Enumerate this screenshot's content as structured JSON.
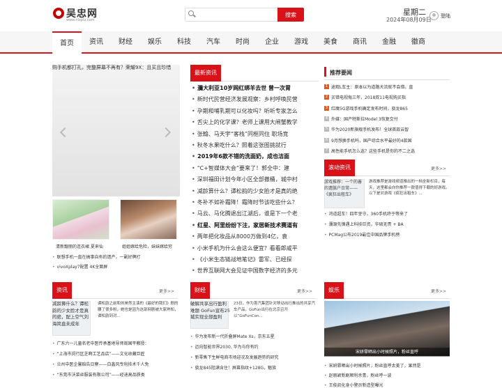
{
  "header": {
    "logo_text": "吴忠网",
    "logo_sub": "www.nlxplz.com",
    "search_button": "搜索",
    "weekday": "星期二",
    "date": "2024年08月09日",
    "login": "登陆"
  },
  "nav": {
    "items": [
      "首页",
      "资讯",
      "财经",
      "娱乐",
      "科技",
      "汽车",
      "时尚",
      "企业",
      "游戏",
      "美食",
      "商讯",
      "金融",
      "徽商"
    ]
  },
  "slider": {
    "caption": "购手机都打孔，完整屏幕不再有？荣耀9X：且买且珍惜"
  },
  "thumbs": [
    {
      "caption": "清新靓丽的连衣裙 夏来仙"
    },
    {
      "caption": "姐姐嫁给危险，妹妹嫁给穷"
    }
  ],
  "left_links": [
    "联想手机一直在搞事自有的遗产，一副好牌打",
    "vivoXplay7配置 4K全面屏"
  ],
  "latest": {
    "title": "最新资讯",
    "items": [
      {
        "text": "瀰大利亚10岁网红绑羊去世 曾一次胃",
        "bold": true
      },
      {
        "text": "新时代民营经济发展观察：乡村呼唤民营",
        "bold": false
      },
      {
        "text": "孕期和哺乳期可以化妆吗？听听专家怎么",
        "bold": false
      },
      {
        "text": "舌尖上的化学课？老师上课用大闸蟹教学",
        "bold": false
      },
      {
        "text": "张翰、马天宇“客栈”同框同住 职场竞",
        "bold": false
      },
      {
        "text": "秋冬水果吃什么？照着这张图挑就行",
        "bold": false
      },
      {
        "text": "2019年6款不错的洗面奶，成也洁面",
        "bold": true
      },
      {
        "text": "“C+智媒体大会”要来了！郭全中：建",
        "bold": false
      },
      {
        "text": "深圳福田计划今年小区全部撤桶，城中村",
        "bold": false
      },
      {
        "text": "减龄算什么？谭松韵的少女脸才是真的绝",
        "bold": false
      },
      {
        "text": "冬补不如补霜降！霜降时节该吃些什么？",
        "bold": false
      },
      {
        "text": "马云、马化腾退出江湖后，谁是下一个老",
        "bold": false
      },
      {
        "text": "红星、阿里纷纷下注，家居新技术赛道有",
        "bold": true
      },
      {
        "text": "两年把化妆品从8000万做到4亿，袁",
        "bold": false
      },
      {
        "text": "小米手机为什么会这么便宜？看看郎咸平",
        "bold": false
      },
      {
        "text": "《小米生态链战地笔记》雷军、已经探",
        "bold": false
      },
      {
        "text": "世界互联网大会见证中国数字经济的多元",
        "bold": false
      }
    ]
  },
  "recommend": {
    "title": "推荐要闻",
    "items": [
      "途观L车主：原本以为道路大流就不会错，直",
      "买错电视侮三年，2018双11电视购买指",
      "红魔5G游戏手机确定发布时间，骁龙865",
      "外媒：国产特斯拉Model 3恢复交付",
      "华为2020新旗舰手机发布！全球首款云智",
      "9月想换手机吗，国产综合水平最好的4款国",
      "高性能手机怎么选？这些手机是你的不二之选"
    ]
  },
  "scroll": {
    "title": "滚动资讯",
    "more": "更多>>",
    "img_alt": "游戏推荐：一个的善的遗骸户日常——《疯狂出租车》",
    "desc": "游戏推荐是游戏频道推出的一档全新栏目，每天，这里都会向你推荐一款值得下载的好游戏。以下是对游戏《疯狂出租车》...",
    "links": [
      "鸿道超车！四年坚守，360手机终于等来了",
      "瀰源先锋遇上科技巨资，华硕无畏 + BA",
      "PCMag公布2019最佳中国品牌手机榜"
    ]
  },
  "bottom": [
    {
      "title": "资讯",
      "more": "更多>>",
      "img_alt": "减龄算什么？谭松韵的少女脸才是真的绝，配上空气刘海简直未成年",
      "desc": "谭松韵之前和刘昊然主演的《最好的我们》剧的腰了很多粉，她也是因为这部网剧被大家熟知，谭松韵到对...",
      "links": [
        "广东六一儿童名老中医传承基地导师周国平教授：",
        "“上海市闵行区芝啊工艺品店”——文化收藏巨匠",
        "兰州中医企馨赔告日寮——白鑫风专利技术千人免",
        "“东莞市沃菜丝服装有限公司”——经迪高品质类"
      ]
    },
    {
      "title": "财经",
      "more": "更多>>",
      "img_alt": "破解共享出行盈利难题 GoFun宣布25城实现全部盈利",
      "desc": "23日，作为首汽集团针对移动出行推出的共享汽车产品，GoFun出行在北京召开以“GoFunCon...",
      "links": [
        "华为发布新一代折叠屏Mate Xs，京东五星",
        "迈向智能世界2030, 华为与你有约",
        "新零售下生鲜电商市场迎况及发展趋势的研究",
        "骁龙845阻满含住！屏幕指纹+128G，魅族"
      ]
    },
    {
      "title": "娱乐",
      "more": "更多>>",
      "img_caption": "宋妍霏晒出小时候照片，粉丝直呼",
      "links": [
        "宋妍霏晒出小时候照片，粉丝直呼太美了，果然是",
        "赵丽颖新剧顺利杀青，粉丝呼一波",
        "王俊凯化身小警员新造型曝光"
      ]
    }
  ]
}
